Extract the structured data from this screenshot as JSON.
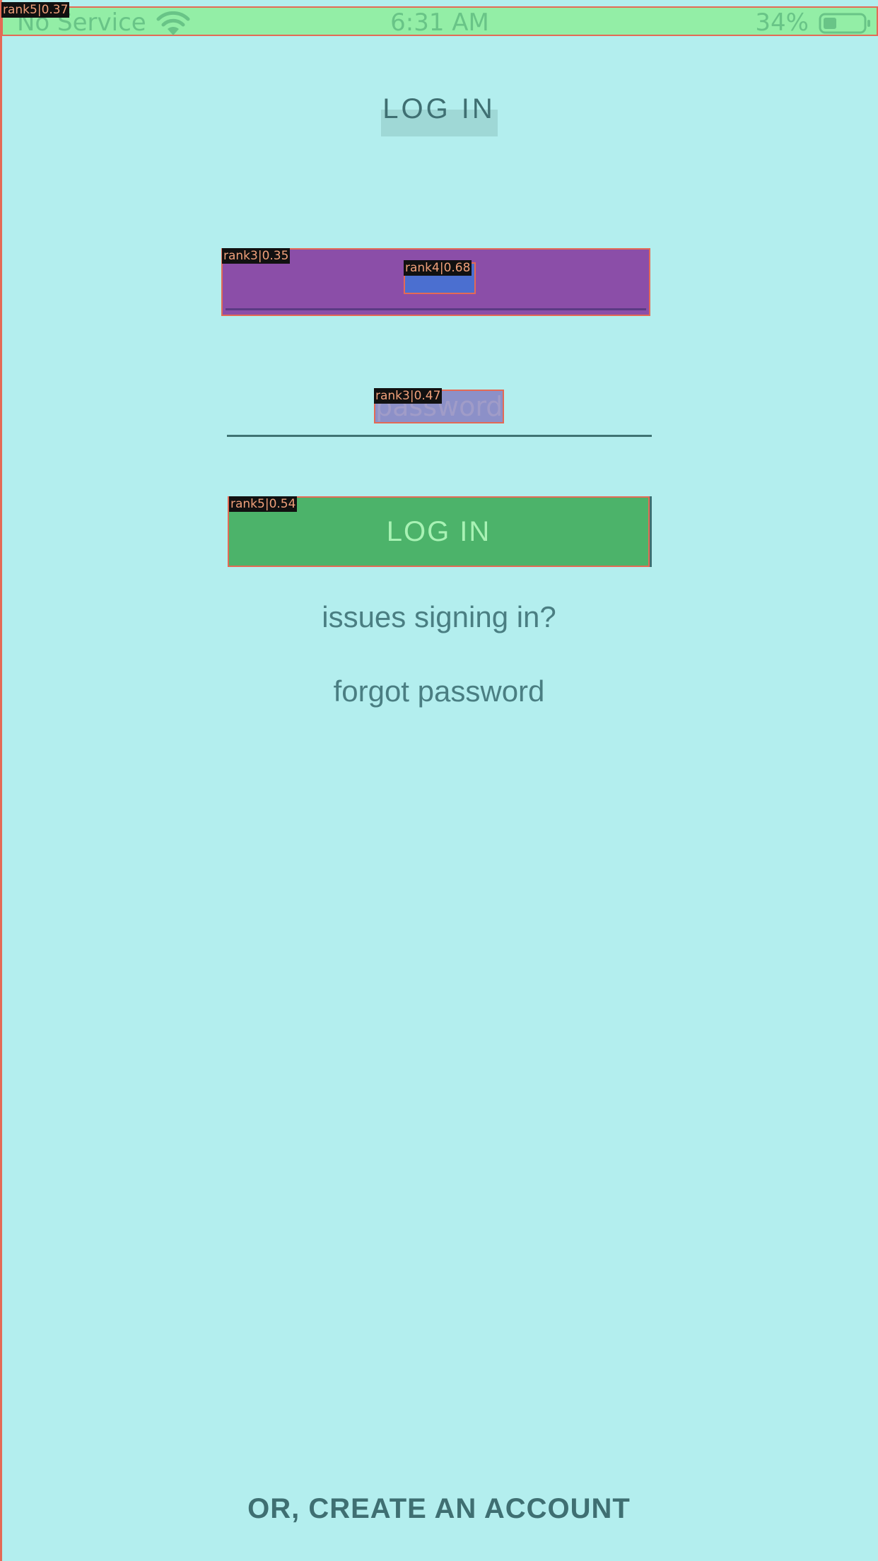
{
  "status_bar": {
    "carrier": "No Service",
    "time": "6:31 AM",
    "battery_percent": "34%",
    "wifi_icon": "wifi-icon",
    "battery_icon": "battery-icon",
    "battery_level": 0.34
  },
  "header": {
    "title": "LOG IN"
  },
  "form": {
    "username_placeholder": "",
    "password_placeholder": "password",
    "login_label": "LOG IN",
    "issues_link": "issues signing in?",
    "forgot_link": "forgot password"
  },
  "footer": {
    "create_account_label": "OR, CREATE AN ACCOUNT"
  },
  "annotations": {
    "status_bar_tag": "rank5|0.37",
    "username_field_tag": "rank3|0.35",
    "username_placeholder_tag": "rank4|0.68",
    "password_placeholder_tag": "rank3|0.47",
    "login_button_tag": "rank5|0.54"
  },
  "colors": {
    "background": "#b3eeee",
    "accent_green": "#4cb36a",
    "text_teal": "#3f6f72"
  }
}
